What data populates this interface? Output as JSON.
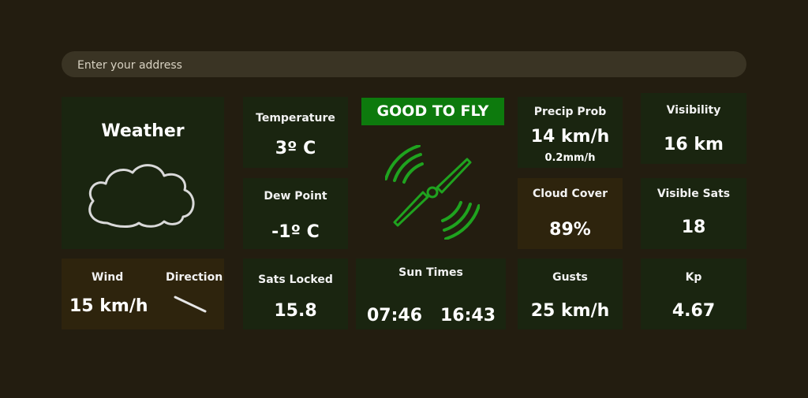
{
  "search": {
    "placeholder": "Enter your address"
  },
  "weather": {
    "title": "Weather",
    "icon": "cloud-icon"
  },
  "wind": {
    "label": "Wind",
    "direction_label": "Direction",
    "value": "15 km/h",
    "direction_icon": "wind-direction-arrow-icon"
  },
  "temperature": {
    "label": "Temperature",
    "value": "3º C"
  },
  "dew_point": {
    "label": "Dew Point",
    "value": "-1º C"
  },
  "sats_locked": {
    "label": "Sats Locked",
    "value": "15.8"
  },
  "status": {
    "text": "GOOD TO FLY",
    "color": "#0d7a0d",
    "icon": "drone-propeller-signal-icon"
  },
  "sun_times": {
    "label": "Sun Times",
    "sunrise": "07:46",
    "sunset": "16:43"
  },
  "precip": {
    "label": "Precip Prob",
    "value": "14 km/h",
    "sub": "0.2mm/h"
  },
  "cloud_cover": {
    "label": "Cloud Cover",
    "value": "89%"
  },
  "gusts": {
    "label": "Gusts",
    "value": "25 km/h"
  },
  "visibility": {
    "label": "Visibility",
    "value": "16 km"
  },
  "visible_sats": {
    "label": "Visible Sats",
    "value": "18"
  },
  "kp": {
    "label": "Kp",
    "value": "4.67"
  },
  "colors": {
    "background": "#231d10",
    "card": "#1a2510",
    "card_alt": "#2e240d",
    "accent": "#0d7a0d",
    "icon_green": "#1fa31f"
  }
}
